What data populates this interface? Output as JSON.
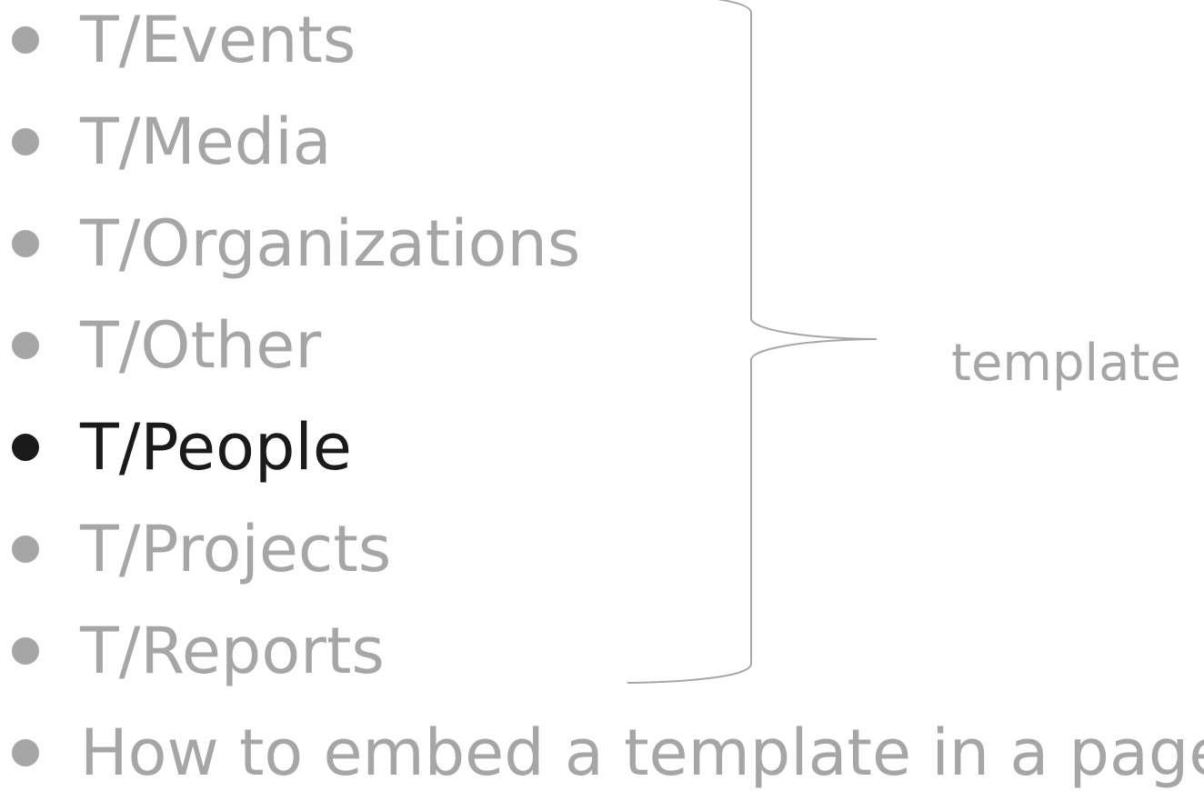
{
  "items": [
    {
      "label": "T/Events",
      "active": false
    },
    {
      "label": "T/Media",
      "active": false
    },
    {
      "label": "T/Organizations",
      "active": false
    },
    {
      "label": "T/Other",
      "active": false
    },
    {
      "label": "T/People",
      "active": true
    },
    {
      "label": "T/Projects",
      "active": false
    },
    {
      "label": "T/Reports",
      "active": false
    },
    {
      "label": "How to embed a template in a page",
      "active": false
    }
  ],
  "brace": {
    "label": "template",
    "covers": [
      "T/Events",
      "T/Media",
      "T/Organizations",
      "T/Other",
      "T/People",
      "T/Projects",
      "T/Reports"
    ]
  },
  "colors": {
    "inactive_text": "#a6a6a6",
    "active_text": "#1a1a1a",
    "brace_stroke": "#a6a6a6"
  }
}
